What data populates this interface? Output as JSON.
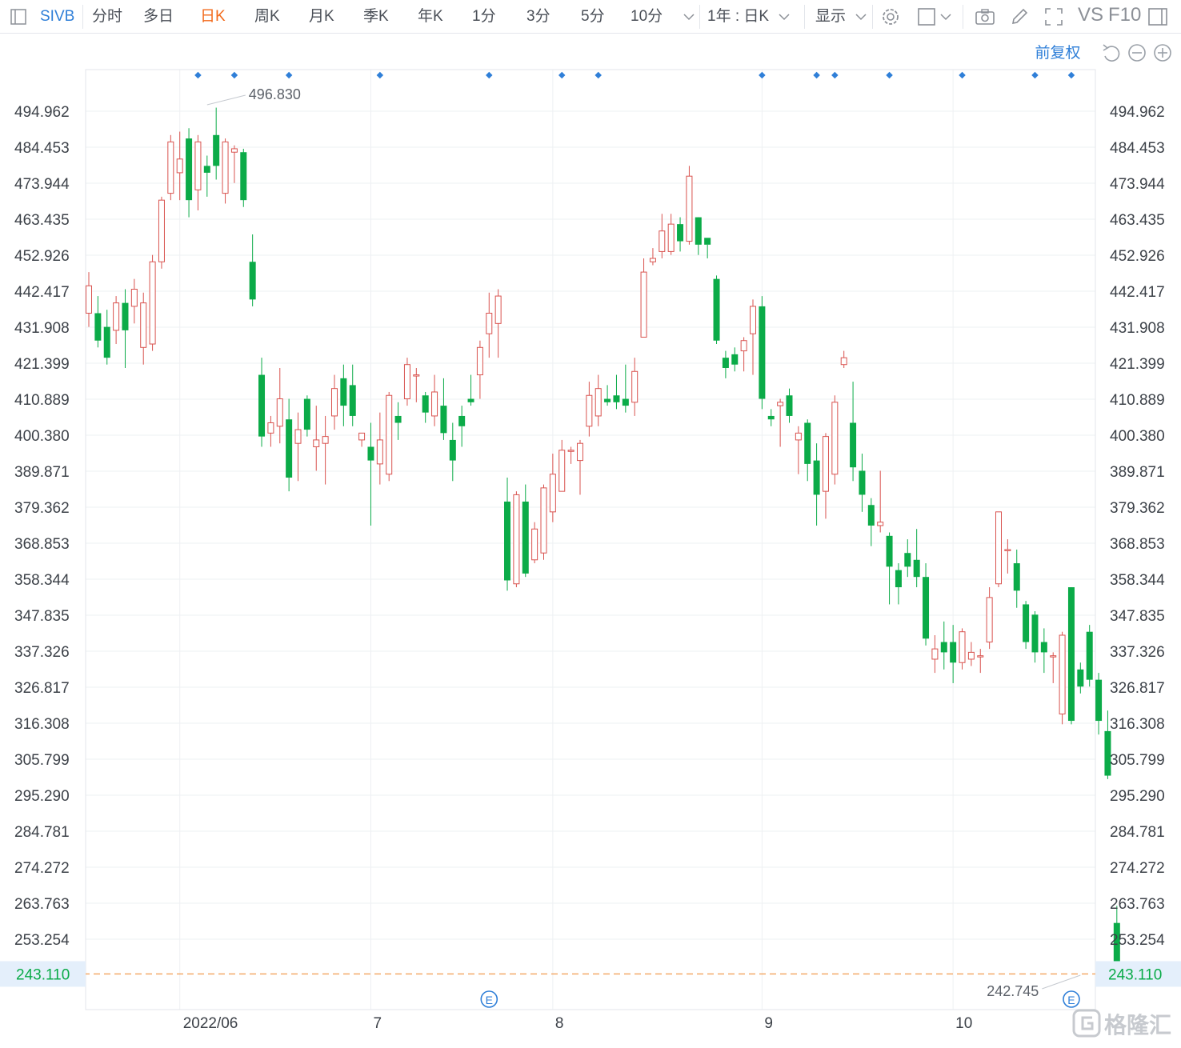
{
  "toolbar": {
    "symbol": "SIVB",
    "periods": [
      "分时",
      "多日",
      "日K",
      "周K",
      "月K",
      "季K",
      "年K",
      "1分",
      "3分",
      "5分",
      "10分"
    ],
    "active_period": "日K",
    "range_select": "1年 : 日K",
    "display_label": "显示",
    "vs_label": "VS",
    "f10_label": "F10"
  },
  "chart_header": {
    "adjust_label": "前复权"
  },
  "watermark": {
    "text": "格隆汇"
  },
  "colors": {
    "up": "#d9534f",
    "down": "#0bab48",
    "current_price": "#0bab48",
    "current_line": "#f2a25c",
    "event": "#2f7fd8",
    "grid": "#eef0f3"
  },
  "chart_data": {
    "type": "candlestick",
    "ylim": [
      238.0,
      503.0
    ],
    "y_ticks": [
      494.962,
      484.453,
      473.944,
      463.435,
      452.926,
      442.417,
      431.908,
      421.399,
      410.889,
      400.38,
      389.871,
      379.362,
      368.853,
      358.344,
      347.835,
      337.326,
      326.817,
      316.308,
      305.799,
      295.29,
      284.781,
      274.272,
      263.763,
      253.254
    ],
    "y_tick_labels": [
      "494.962",
      "484.453",
      "473.944",
      "463.435",
      "452.926",
      "442.417",
      "431.908",
      "421.399",
      "410.889",
      "400.380",
      "389.871",
      "379.362",
      "368.853",
      "358.344",
      "347.835",
      "337.326",
      "326.817",
      "316.308",
      "305.799",
      "295.290",
      "284.781",
      "274.272",
      "263.763",
      "253.254"
    ],
    "x_ticks": [
      {
        "index": 10,
        "label": "2022/06"
      },
      {
        "index": 31,
        "label": "7"
      },
      {
        "index": 51,
        "label": "8"
      },
      {
        "index": 74,
        "label": "9"
      },
      {
        "index": 95,
        "label": "10"
      }
    ],
    "current_price": 243.11,
    "current_price_label": "243.110",
    "high_marker": {
      "index": 13,
      "value": 496.83,
      "label": "496.830"
    },
    "low_marker": {
      "index": 109,
      "value": 242.745,
      "label": "242.745"
    },
    "event_labels": [
      {
        "index": 44,
        "label": "E"
      },
      {
        "index": 108,
        "label": "E"
      }
    ],
    "news_dots": [
      12,
      16,
      22,
      32,
      44,
      52,
      56,
      74,
      80,
      82,
      88,
      96,
      104,
      108
    ],
    "candles": [
      [
        436,
        444,
        448,
        432
      ],
      [
        436,
        428,
        441,
        426
      ],
      [
        432,
        423,
        437,
        421
      ],
      [
        431,
        439,
        441,
        427
      ],
      [
        439,
        431,
        443,
        420
      ],
      [
        438,
        443,
        446,
        433
      ],
      [
        426,
        439,
        442,
        421
      ],
      [
        427,
        451,
        453,
        425
      ],
      [
        451,
        469,
        470,
        449
      ],
      [
        471,
        486,
        488,
        469
      ],
      [
        477,
        481,
        489,
        469
      ],
      [
        487,
        469,
        490,
        464
      ],
      [
        472,
        486,
        488,
        466
      ],
      [
        479,
        477,
        482,
        470
      ],
      [
        488,
        479,
        496,
        475
      ],
      [
        471,
        486,
        487,
        468
      ],
      [
        483,
        484,
        485,
        474
      ],
      [
        483,
        469,
        484,
        467
      ],
      [
        451,
        440,
        459,
        438
      ],
      [
        418,
        400,
        423,
        397
      ],
      [
        401,
        404,
        406,
        397
      ],
      [
        403,
        411,
        420,
        398
      ],
      [
        405,
        388,
        411,
        384
      ],
      [
        398,
        402,
        407,
        387
      ],
      [
        411,
        402,
        412,
        400
      ],
      [
        397,
        399,
        409,
        390
      ],
      [
        398,
        400,
        406,
        386
      ],
      [
        406,
        414,
        418,
        402
      ],
      [
        417,
        409,
        421,
        403
      ],
      [
        415,
        406,
        421,
        403
      ],
      [
        399,
        401,
        401,
        397
      ],
      [
        397,
        393,
        404,
        374
      ],
      [
        392,
        399,
        407,
        386
      ],
      [
        389,
        412,
        413,
        387
      ],
      [
        406,
        404,
        410,
        399
      ],
      [
        411,
        421,
        423,
        409
      ],
      [
        418,
        418,
        420,
        410
      ],
      [
        412,
        407,
        413,
        404
      ],
      [
        406,
        413,
        418,
        403
      ],
      [
        409,
        401,
        417,
        399
      ],
      [
        399,
        393,
        404,
        387
      ],
      [
        406,
        403,
        409,
        397
      ],
      [
        411,
        410,
        418,
        409
      ],
      [
        418,
        426,
        428,
        411
      ],
      [
        430,
        436,
        442,
        423
      ],
      [
        433,
        441,
        443,
        423
      ],
      [
        381,
        358,
        388,
        355
      ],
      [
        357,
        383,
        384,
        356
      ],
      [
        381,
        360,
        386,
        359
      ],
      [
        364,
        373,
        375,
        363
      ],
      [
        366,
        385,
        386,
        364
      ],
      [
        378,
        389,
        395,
        375
      ],
      [
        384,
        396,
        399,
        385
      ],
      [
        396,
        396,
        397,
        392
      ],
      [
        393,
        398,
        399,
        383
      ],
      [
        403,
        412,
        416,
        400
      ],
      [
        406,
        414,
        418,
        403
      ],
      [
        411,
        410,
        415,
        409
      ],
      [
        412,
        410,
        418,
        408
      ],
      [
        411,
        409,
        421,
        407
      ],
      [
        410,
        419,
        423,
        406
      ],
      [
        429,
        448,
        452,
        429
      ],
      [
        451,
        452,
        455,
        450
      ],
      [
        454,
        460,
        465,
        452
      ],
      [
        454,
        462,
        465,
        453
      ],
      [
        462,
        457,
        464,
        454
      ],
      [
        457,
        476,
        479,
        456
      ],
      [
        464,
        456,
        464,
        453
      ],
      [
        458,
        456,
        456,
        452
      ],
      [
        446,
        428,
        447,
        427
      ],
      [
        423,
        420,
        425,
        417
      ],
      [
        424,
        421,
        426,
        419
      ],
      [
        425,
        428,
        429,
        419
      ],
      [
        430,
        438,
        440,
        418
      ],
      [
        438,
        411,
        441,
        408
      ],
      [
        406,
        405,
        408,
        403
      ],
      [
        409,
        410,
        411,
        397
      ],
      [
        412,
        406,
        414,
        404
      ],
      [
        399,
        401,
        403,
        389
      ],
      [
        404,
        392,
        405,
        387
      ],
      [
        393,
        383,
        398,
        374
      ],
      [
        384,
        400,
        401,
        376
      ],
      [
        389,
        410,
        412,
        386
      ],
      [
        421,
        423,
        425,
        420
      ],
      [
        404,
        391,
        416,
        387
      ],
      [
        390,
        383,
        395,
        378
      ],
      [
        380,
        374,
        382,
        368
      ],
      [
        374,
        375,
        390,
        372
      ],
      [
        371,
        362,
        372,
        351
      ],
      [
        361,
        356,
        363,
        351
      ],
      [
        366,
        362,
        370,
        359
      ],
      [
        364,
        359,
        373,
        356
      ],
      [
        359,
        341,
        363,
        339
      ],
      [
        335,
        338,
        342,
        331
      ],
      [
        340,
        337,
        346,
        332
      ],
      [
        340,
        334,
        345,
        328
      ],
      [
        334,
        343,
        344,
        332
      ],
      [
        335,
        337,
        340,
        333
      ],
      [
        336,
        336,
        338,
        331
      ],
      [
        340,
        353,
        356,
        338
      ],
      [
        357,
        378,
        378,
        356
      ],
      [
        367,
        367,
        370,
        360
      ],
      [
        363,
        355,
        367,
        350
      ],
      [
        351,
        340,
        352,
        338
      ],
      [
        348,
        337,
        349,
        334
      ],
      [
        340,
        337,
        344,
        331
      ],
      [
        336,
        336,
        337,
        328
      ],
      [
        319,
        342,
        343,
        316
      ],
      [
        356,
        317,
        356,
        316
      ],
      [
        332,
        327,
        334,
        325
      ],
      [
        343,
        329,
        345,
        327
      ],
      [
        329,
        317,
        331,
        313
      ],
      [
        314,
        301,
        320,
        300
      ],
      [
        258,
        246,
        263,
        243
      ]
    ]
  }
}
